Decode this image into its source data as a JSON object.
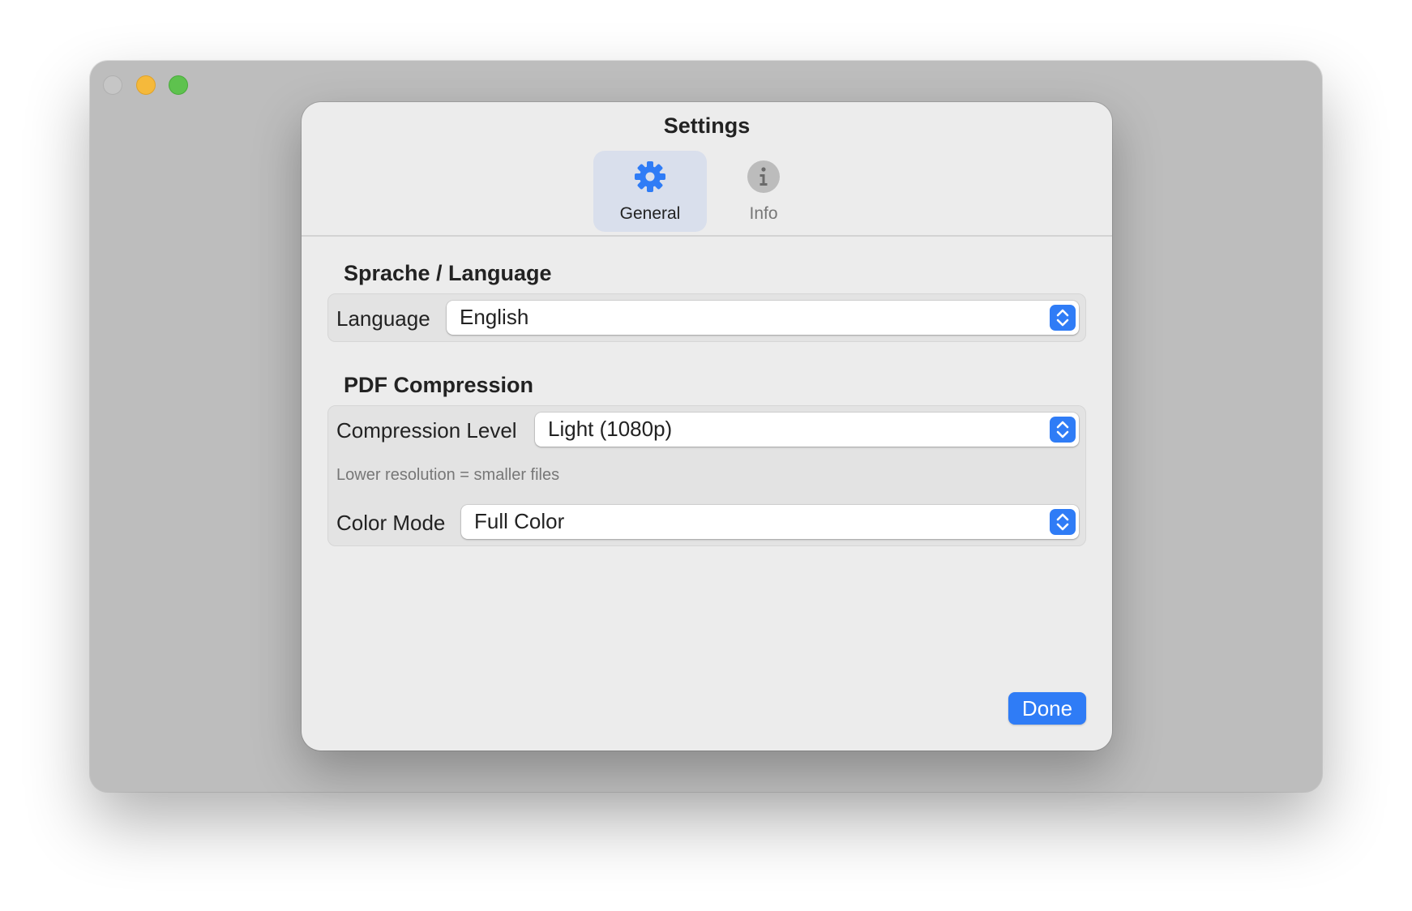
{
  "window": {
    "traffic_lights": [
      "close",
      "minimize",
      "maximize"
    ]
  },
  "sheet": {
    "title": "Settings",
    "tabs": [
      {
        "label": "General",
        "icon": "gear-icon",
        "selected": true
      },
      {
        "label": "Info",
        "icon": "info-icon",
        "selected": false
      }
    ],
    "language_section": {
      "title": "Sprache / Language",
      "language": {
        "label": "Language",
        "value": "English"
      }
    },
    "pdf_section": {
      "title": "PDF Compression",
      "compression": {
        "label": "Compression Level",
        "value": "Light (1080p)",
        "hint": "Lower resolution = smaller files"
      },
      "color_mode": {
        "label": "Color Mode",
        "value": "Full Color"
      }
    },
    "done_label": "Done"
  },
  "colors": {
    "accent": "#2f7cf6",
    "selected_tab_bg": "#d9dfec",
    "sheet_bg": "#ececec",
    "window_bg": "#bdbdbd"
  }
}
